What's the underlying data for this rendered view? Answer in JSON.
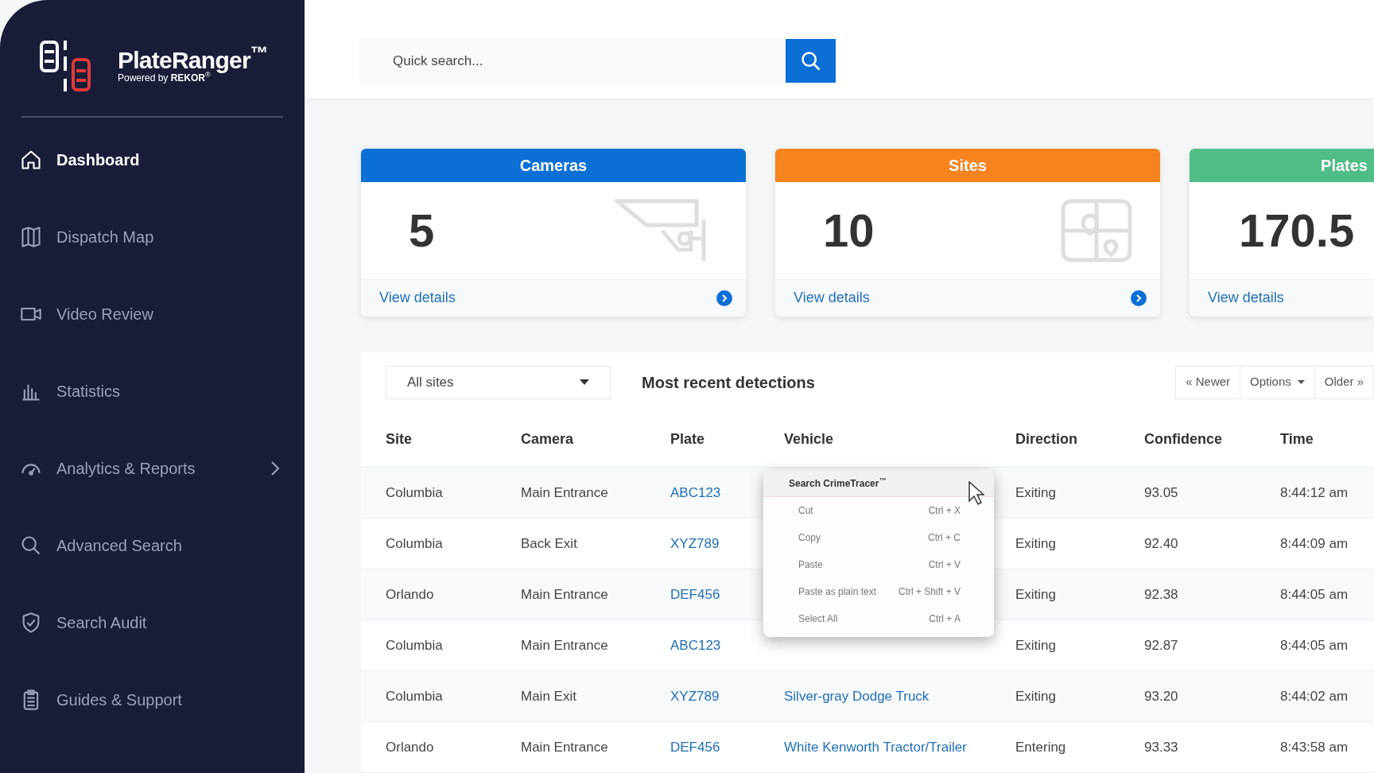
{
  "sidebar": {
    "logo": {
      "name": "PlateRanger$^{™}$",
      "tagline": "Powered by **REKOR**$^{®}$"
    },
    "items": [
      {
        "label": "Dashboard",
        "kind": "home",
        "selected": true,
        "expandable": false
      },
      {
        "label": "Dispatch Map",
        "kind": "map",
        "selected": false,
        "expandable": false
      },
      {
        "label": "Video Review",
        "kind": "video",
        "selected": false,
        "expandable": false
      },
      {
        "label": "Statistics",
        "kind": "chart",
        "selected": false,
        "expandable": false
      },
      {
        "label": "Analytics & Reports",
        "kind": "gauge",
        "selected": false,
        "expandable": true
      },
      {
        "label": "Advanced Search",
        "kind": "search",
        "selected": false,
        "expandable": false
      },
      {
        "label": "Search Audit",
        "kind": "shield",
        "selected": false,
        "expandable": false
      },
      {
        "label": "Guides & Support",
        "kind": "clipboard",
        "selected": false,
        "expandable": false
      }
    ]
  },
  "search": {
    "placeholder": "Quick search..."
  },
  "cards": [
    {
      "title": "Cameras",
      "value": "5",
      "link": "View details",
      "color": "#0b6fd6",
      "kind": "camera",
      "arrow": true
    },
    {
      "title": "Sites",
      "value": "10",
      "link": "View details",
      "color": "#f6831e",
      "kind": "map",
      "arrow": true
    },
    {
      "title": "Plates",
      "value": "170.5",
      "link": "View details",
      "color": "#4fbd85",
      "kind": "plain",
      "arrow": false
    }
  ],
  "detections": {
    "filter": "All sites",
    "title": "Most recent detections",
    "pager": [
      {
        "label": "« Newer",
        "kind": "plain"
      },
      {
        "label": "Options",
        "kind": "dropdown"
      },
      {
        "label": "Older »",
        "kind": "plain"
      }
    ],
    "columns": [
      "Site",
      "Camera",
      "Plate",
      "Vehicle",
      "Direction",
      "Confidence",
      "Time"
    ],
    "rows": [
      {
        "site": "Columbia",
        "camera": "Main Entrance",
        "plate": "ABC123",
        "direction": "Exiting",
        "confidence": "93.05",
        "time": "8:44:12 am"
      },
      {
        "site": "Columbia",
        "camera": "Back Exit",
        "plate": "XYZ789",
        "direction": "Exiting",
        "confidence": "92.40",
        "time": "8:44:09 am"
      },
      {
        "site": "Orlando",
        "camera": "Main Entrance",
        "plate": "DEF456",
        "direction": "Exiting",
        "confidence": "92.38",
        "time": "8:44:05 am"
      },
      {
        "site": "Columbia",
        "camera": "Main Entrance",
        "plate": "ABC123",
        "direction": "Exiting",
        "confidence": "92.87",
        "time": "8:44:05 am"
      },
      {
        "site": "Columbia",
        "camera": "Main Exit",
        "plate": "XYZ789",
        "vehicle": "Silver-gray Dodge Truck",
        "direction": "Exiting",
        "confidence": "93.20",
        "time": "8:44:02 am"
      },
      {
        "site": "Orlando",
        "camera": "Main Entrance",
        "plate": "DEF456",
        "vehicle": "White Kenworth Tractor/Trailer",
        "direction": "Entering",
        "confidence": "93.33",
        "time": "8:43:58 am"
      }
    ]
  },
  "context_menu": {
    "items": [
      {
        "label": "Search CrimeTracer$^{™}$",
        "kind": "header",
        "selected": true
      },
      {
        "label": "Cut",
        "shortcut": "Ctrl + X",
        "kind": "command",
        "selected": false
      },
      {
        "label": "Copy",
        "shortcut": "Ctrl + C",
        "kind": "command",
        "selected": false
      },
      {
        "label": "Paste",
        "shortcut": "Ctrl + V",
        "kind": "command",
        "selected": false
      },
      {
        "label": "Paste as plain text",
        "shortcut": "Ctrl + Shift + V",
        "kind": "command",
        "selected": false
      },
      {
        "label": "Select All",
        "shortcut": "Ctrl + A",
        "kind": "command",
        "selected": false
      }
    ]
  }
}
